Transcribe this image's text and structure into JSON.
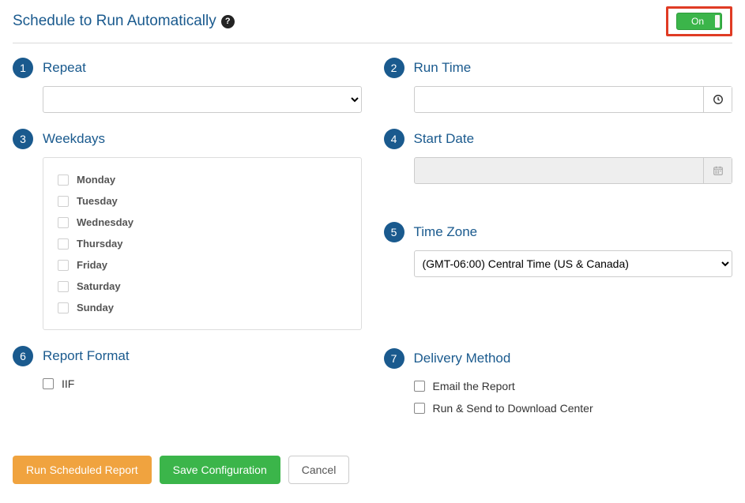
{
  "header": {
    "title": "Schedule to Run Automatically",
    "toggle_label": "On"
  },
  "sections": {
    "repeat": {
      "num": "1",
      "title": "Repeat",
      "value": ""
    },
    "runtime": {
      "num": "2",
      "title": "Run Time",
      "value": ""
    },
    "weekdays": {
      "num": "3",
      "title": "Weekdays",
      "days": [
        "Monday",
        "Tuesday",
        "Wednesday",
        "Thursday",
        "Friday",
        "Saturday",
        "Sunday"
      ]
    },
    "startdate": {
      "num": "4",
      "title": "Start Date",
      "value": ""
    },
    "timezone": {
      "num": "5",
      "title": "Time Zone",
      "value": "(GMT-06:00) Central Time (US & Canada)"
    },
    "format": {
      "num": "6",
      "title": "Report Format",
      "option": "IIF"
    },
    "delivery": {
      "num": "7",
      "title": "Delivery Method",
      "options": [
        "Email the Report",
        "Run & Send to Download Center"
      ]
    }
  },
  "buttons": {
    "run": "Run Scheduled Report",
    "save": "Save Configuration",
    "cancel": "Cancel"
  }
}
